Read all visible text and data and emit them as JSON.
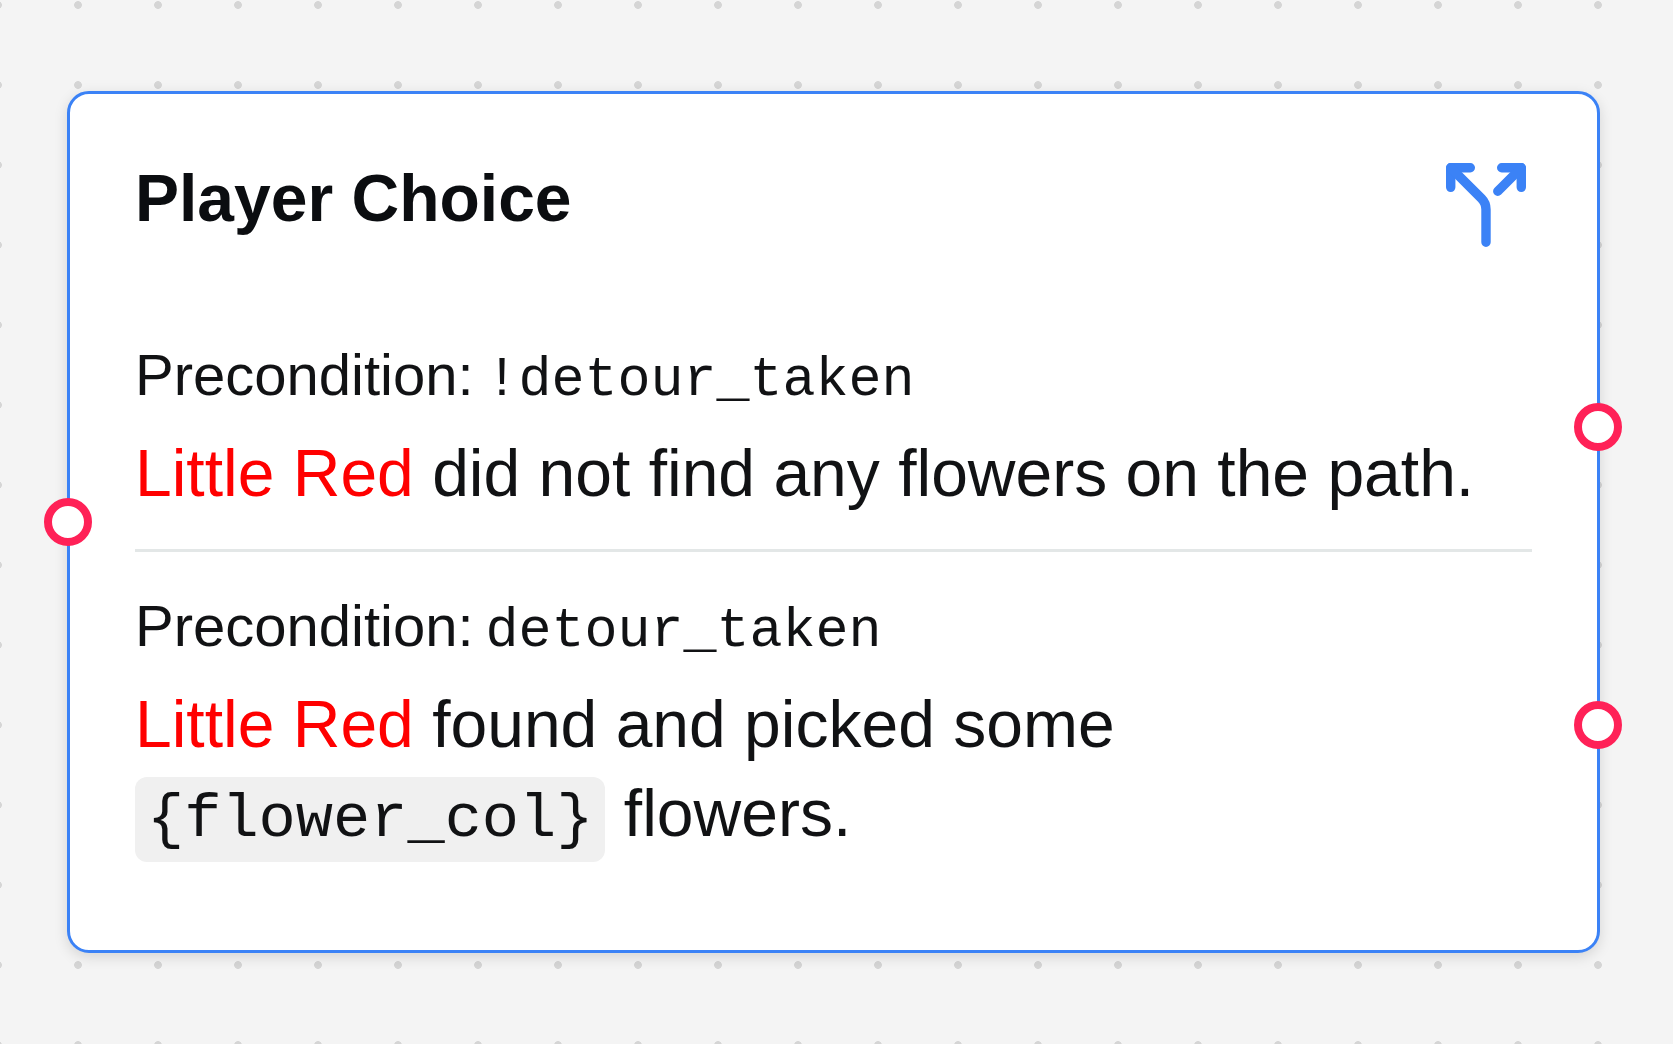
{
  "node": {
    "title": "Player Choice",
    "options": [
      {
        "precondition": {
          "label": "Precondition:",
          "expression": "!detour_taken"
        },
        "text": [
          {
            "kind": "speaker",
            "text": "Little Red"
          },
          {
            "kind": "plain",
            "text": " did not find any flowers on the path."
          }
        ]
      },
      {
        "precondition": {
          "label": "Precondition:",
          "expression": "detour_taken"
        },
        "text": [
          {
            "kind": "speaker",
            "text": "Little Red"
          },
          {
            "kind": "plain",
            "text": " found and picked some "
          },
          {
            "kind": "variable",
            "text": "{flower_col}"
          },
          {
            "kind": "plain",
            "text": " flowers."
          }
        ]
      }
    ]
  }
}
